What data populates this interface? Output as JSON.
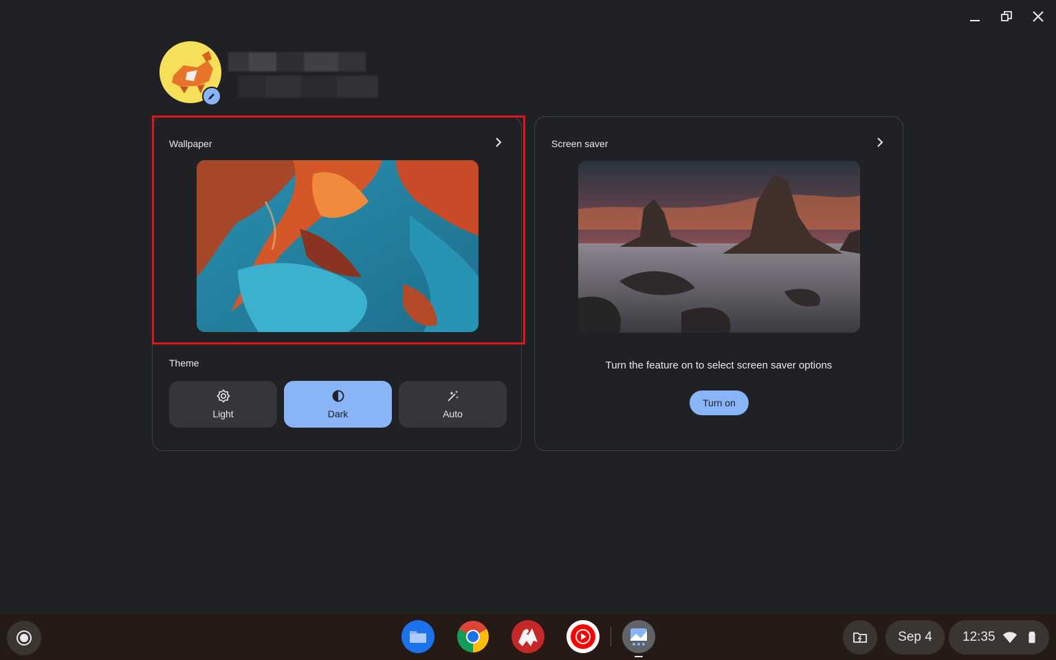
{
  "window_controls": {
    "minimize": "minimize-icon",
    "maximize": "restore-icon",
    "close": "close-icon"
  },
  "wallpaper_card": {
    "title": "Wallpaper"
  },
  "theme": {
    "label": "Theme",
    "options": [
      {
        "label": "Light",
        "icon": "brightness-icon",
        "selected": false
      },
      {
        "label": "Dark",
        "icon": "half-circle-icon",
        "selected": true
      },
      {
        "label": "Auto",
        "icon": "magic-wand-icon",
        "selected": false
      }
    ]
  },
  "screensaver_card": {
    "title": "Screen saver",
    "message": "Turn the feature on to select screen saver options",
    "button_label": "Turn on"
  },
  "shelf": {
    "apps": [
      "files-icon",
      "chrome-icon",
      "game-app-icon",
      "youtube-music-icon",
      "wallpaper-app-icon"
    ],
    "date": "Sep 4",
    "time": "12:35"
  },
  "colors": {
    "accent": "#8ab4f8",
    "highlight": "#e1141c",
    "background": "#202124"
  }
}
